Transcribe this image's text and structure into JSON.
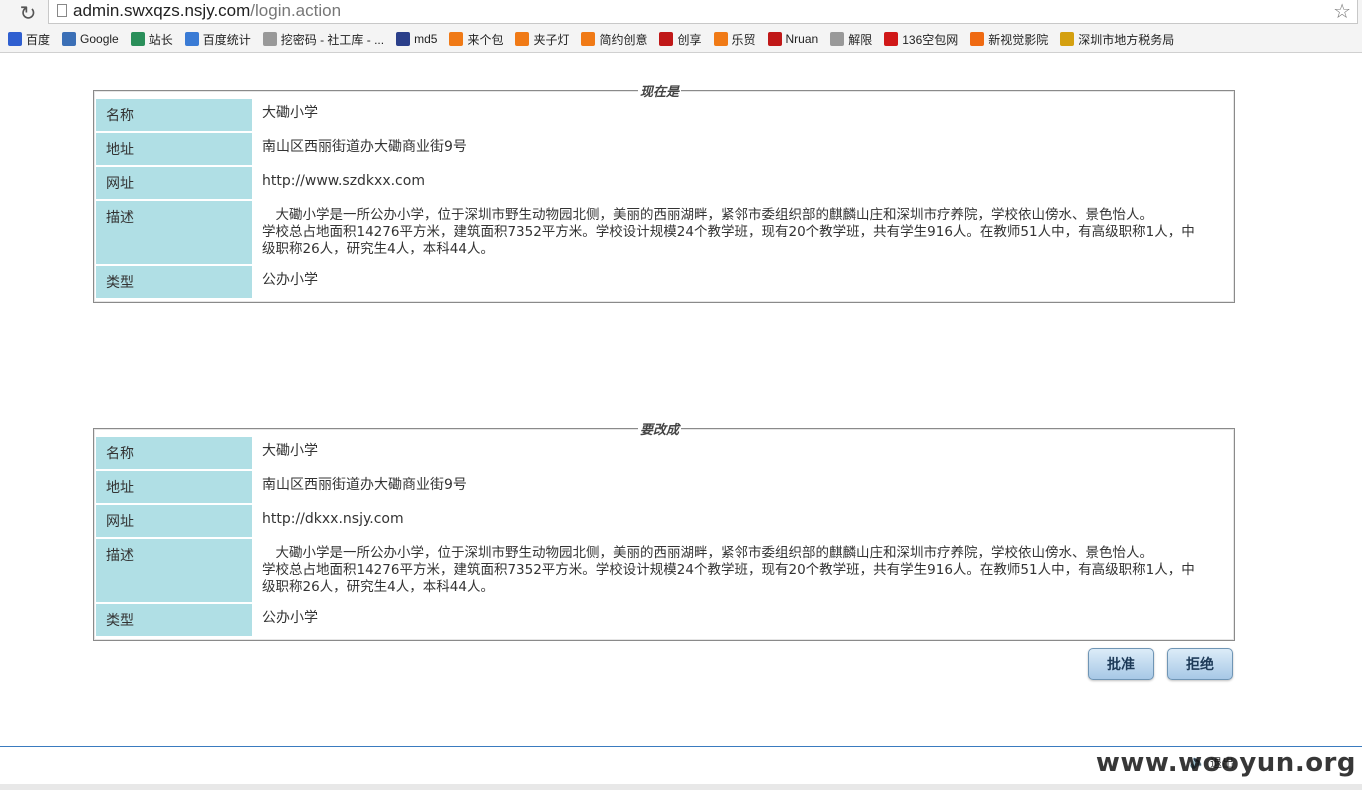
{
  "browser": {
    "url_host": "admin.swxqzs.nsjy.com",
    "url_path": "/login.action",
    "bookmarks": [
      {
        "label": "百度",
        "icon": "baidu-paw-icon",
        "color": "#2f5fd0"
      },
      {
        "label": "Google",
        "icon": "google-bird-icon",
        "color": "#3b6fb6"
      },
      {
        "label": "站长",
        "icon": "zhanzhang-icon",
        "color": "#2a8f5a"
      },
      {
        "label": "百度统计",
        "icon": "chart-icon",
        "color": "#3a7bd5"
      },
      {
        "label": "挖密码 - 社工库 - ...",
        "icon": "page-icon",
        "color": "#999999"
      },
      {
        "label": "md5",
        "icon": "grid-icon",
        "color": "#2b3f8a"
      },
      {
        "label": "来个包",
        "icon": "taobao-icon",
        "color": "#f07a16"
      },
      {
        "label": "夹子灯",
        "icon": "taobao-icon",
        "color": "#f07a16"
      },
      {
        "label": "简约创意",
        "icon": "taobao-icon",
        "color": "#f07a16"
      },
      {
        "label": "创享",
        "icon": "t-icon",
        "color": "#c01818"
      },
      {
        "label": "乐贸",
        "icon": "taobao-icon",
        "color": "#f07a16"
      },
      {
        "label": "Nruan",
        "icon": "n-icon",
        "color": "#c01818"
      },
      {
        "label": "解限",
        "icon": "page-icon",
        "color": "#999999"
      },
      {
        "label": "136空包网",
        "icon": "dan-icon",
        "color": "#d01818"
      },
      {
        "label": "新视觉影院",
        "icon": "film-icon",
        "color": "#ef6a12"
      },
      {
        "label": "深圳市地方税务局",
        "icon": "shui-icon",
        "color": "#d4a010"
      }
    ]
  },
  "current": {
    "legend": "现在是",
    "rows": {
      "name": {
        "label": "名称",
        "value": "大磡小学"
      },
      "address": {
        "label": "地址",
        "value": "南山区西丽街道办大磡商业街9号"
      },
      "website": {
        "label": "网址",
        "value": "http://www.szdkxx.com"
      },
      "description": {
        "label": "描述",
        "line1": "　大磡小学是一所公办小学，位于深圳市野生动物园北侧，美丽的西丽湖畔，紧邻市委组织部的麒麟山庄和深圳市疗养院，学校依山傍水、景色怡人。",
        "line2": "学校总占地面积14276平方米，建筑面积7352平方米。学校设计规模24个教学班，现有20个教学班，共有学生916人。在教师51人中，有高级职称1人，中级职称26人，研究生4人，本科44人。"
      },
      "type": {
        "label": "类型",
        "value": "公办小学"
      }
    }
  },
  "proposed": {
    "legend": "要改成",
    "rows": {
      "name": {
        "label": "名称",
        "value": "大磡小学"
      },
      "address": {
        "label": "地址",
        "value": "南山区西丽街道办大磡商业街9号"
      },
      "website": {
        "label": "网址",
        "value": "http://dkxx.nsjy.com"
      },
      "description": {
        "label": "描述",
        "line1": "　大磡小学是一所公办小学，位于深圳市野生动物园北侧，美丽的西丽湖畔，紧邻市委组织部的麒麟山庄和深圳市疗养院，学校依山傍水、景色怡人。",
        "line2": "学校总占地面积14276平方米，建筑面积7352平方米。学校设计规模24个教学班，现有20个教学班，共有学生916人。在教师51人中，有高级职称1人，中级职称26人，研究生4人，本科44人。"
      },
      "type": {
        "label": "类型",
        "value": "公办小学"
      }
    }
  },
  "actions": {
    "approve_label": "批准",
    "reject_label": "拒绝"
  },
  "status_bar": {
    "text": "退出",
    "watermark": "www.wooyun.org"
  }
}
